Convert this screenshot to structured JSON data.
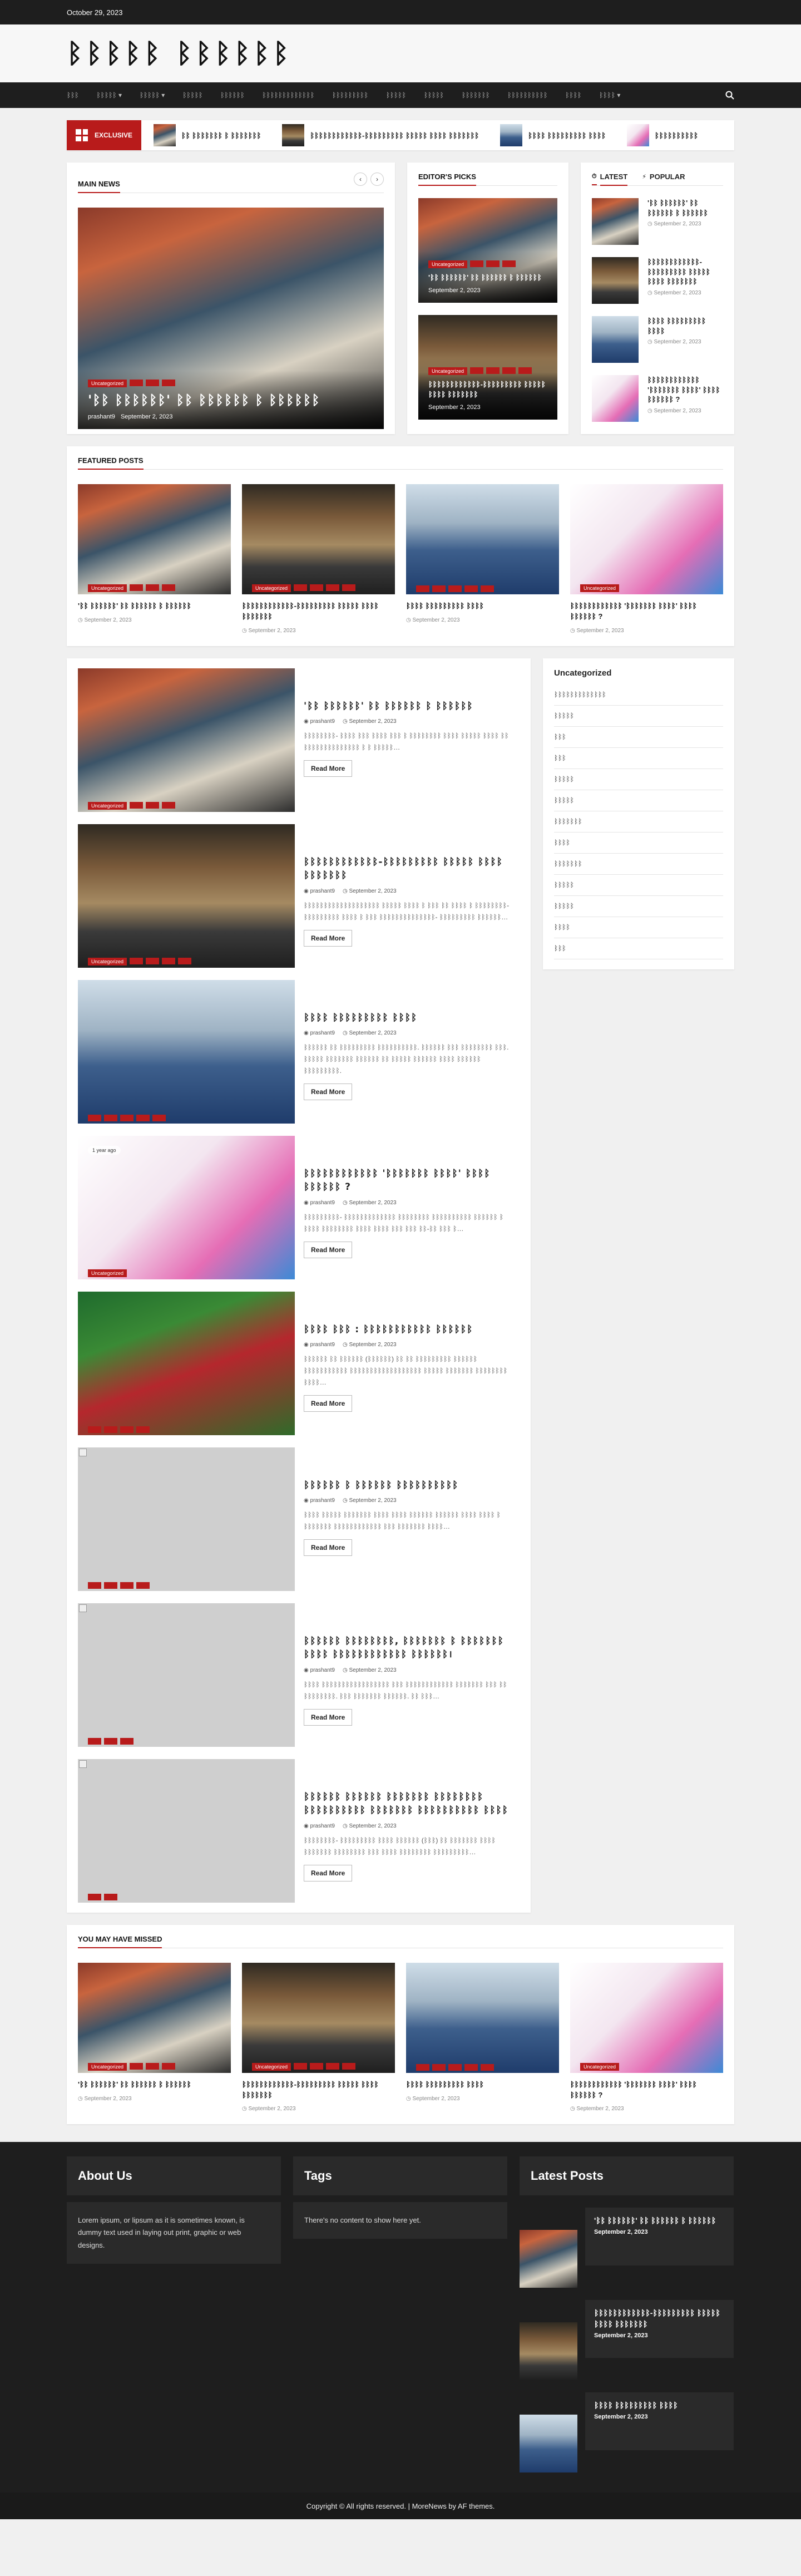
{
  "topbar": {
    "date": "October 29, 2023"
  },
  "site": {
    "title": "ᛒᛒᛒᛒᛒ ᛒᛒᛒᛒᛒᛒ"
  },
  "nav": {
    "items": [
      "ᛒᛒᛒ",
      "ᛒᛒᛒᛒᛒ ▾",
      "ᛒᛒᛒᛒᛒ ▾",
      "ᛒᛒᛒᛒᛒ",
      "ᛒᛒᛒᛒᛒᛒ",
      "ᛒᛒᛒᛒᛒᛒᛒᛒᛒᛒᛒᛒᛒ",
      "ᛒᛒᛒᛒᛒᛒᛒᛒᛒ",
      "ᛒᛒᛒᛒᛒ",
      "ᛒᛒᛒᛒᛒ",
      "ᛒᛒᛒᛒᛒᛒᛒ",
      "ᛒᛒᛒᛒᛒᛒᛒᛒᛒᛒ",
      "ᛒᛒᛒᛒ",
      "ᛒᛒᛒᛒ ▾"
    ],
    "search_icon": "search-icon"
  },
  "ticker": {
    "label": "EXCLUSIVE",
    "items": [
      "ᛒᛒ ᛒᛒᛒᛒᛒᛒᛒ ᛒ ᛒᛒᛒᛒᛒᛒᛒ",
      "ᛒᛒᛒᛒᛒᛒᛒᛒᛒᛒᛒᛒ-ᛒᛒᛒᛒᛒᛒᛒᛒᛒ ᛒᛒᛒᛒᛒ ᛒᛒᛒᛒ ᛒᛒᛒᛒᛒᛒᛒ",
      "ᛒᛒᛒᛒ ᛒᛒᛒᛒᛒᛒᛒᛒᛒ ᛒᛒᛒᛒ",
      "ᛒᛒᛒᛒᛒᛒᛒᛒᛒᛒ"
    ]
  },
  "main_news": {
    "title": "MAIN NEWS",
    "hero": {
      "tags": [
        "Uncategorized",
        "",
        "",
        ""
      ],
      "title": "'ᛒᛒ ᛒᛒᛒᛒᛒᛒ' ᛒᛒ ᛒᛒᛒᛒᛒᛒ ᛒ ᛒᛒᛒᛒᛒᛒ",
      "author": "prashant9",
      "date": "September 2, 2023"
    }
  },
  "editors_picks": {
    "title": "EDITOR'S PICKS",
    "items": [
      {
        "tags": [
          "Uncategorized",
          "",
          "",
          ""
        ],
        "title": "'ᛒᛒ ᛒᛒᛒᛒᛒᛒ' ᛒᛒ ᛒᛒᛒᛒᛒᛒ ᛒ ᛒᛒᛒᛒᛒᛒ",
        "date": "September 2, 2023"
      },
      {
        "tags": [
          "Uncategorized",
          "",
          "",
          "",
          ""
        ],
        "title": "ᛒᛒᛒᛒᛒᛒᛒᛒᛒᛒᛒᛒ-ᛒᛒᛒᛒᛒᛒᛒᛒᛒ ᛒᛒᛒᛒᛒ ᛒᛒᛒᛒ ᛒᛒᛒᛒᛒᛒᛒ",
        "date": "September 2, 2023"
      }
    ]
  },
  "latest_tabs": {
    "tabs": [
      "LATEST",
      "POPULAR"
    ],
    "items": [
      {
        "title": "'ᛒᛒ ᛒᛒᛒᛒᛒᛒ' ᛒᛒ ᛒᛒᛒᛒᛒᛒ ᛒ ᛒᛒᛒᛒᛒᛒ",
        "date": "September 2, 2023"
      },
      {
        "title": "ᛒᛒᛒᛒᛒᛒᛒᛒᛒᛒᛒᛒ-ᛒᛒᛒᛒᛒᛒᛒᛒᛒ ᛒᛒᛒᛒᛒ ᛒᛒᛒᛒ ᛒᛒᛒᛒᛒᛒᛒ",
        "date": "September 2, 2023"
      },
      {
        "title": "ᛒᛒᛒᛒ ᛒᛒᛒᛒᛒᛒᛒᛒᛒ ᛒᛒᛒᛒ",
        "date": "September 2, 2023"
      },
      {
        "title": "ᛒᛒᛒᛒᛒᛒᛒᛒᛒᛒᛒᛒ 'ᛒᛒᛒᛒᛒᛒᛒ ᛒᛒᛒᛒ' ᛒᛒᛒᛒ ᛒᛒᛒᛒᛒᛒ ?",
        "date": "September 2, 2023"
      }
    ]
  },
  "featured": {
    "title": "FEATURED POSTS",
    "items": [
      {
        "tags": [
          "Uncategorized",
          "",
          "",
          ""
        ],
        "title": "'ᛒᛒ ᛒᛒᛒᛒᛒᛒ' ᛒᛒ ᛒᛒᛒᛒᛒᛒ ᛒ ᛒᛒᛒᛒᛒᛒ",
        "date": "September 2, 2023"
      },
      {
        "tags": [
          "Uncategorized",
          "",
          "",
          "",
          ""
        ],
        "title": "ᛒᛒᛒᛒᛒᛒᛒᛒᛒᛒᛒᛒ-ᛒᛒᛒᛒᛒᛒᛒᛒᛒ ᛒᛒᛒᛒᛒ ᛒᛒᛒᛒ ᛒᛒᛒᛒᛒᛒᛒ",
        "date": "September 2, 2023"
      },
      {
        "tags": [
          "",
          "",
          "",
          "",
          ""
        ],
        "title": "ᛒᛒᛒᛒ ᛒᛒᛒᛒᛒᛒᛒᛒᛒ ᛒᛒᛒᛒ",
        "date": "September 2, 2023"
      },
      {
        "tags": [
          "Uncategorized"
        ],
        "title": "ᛒᛒᛒᛒᛒᛒᛒᛒᛒᛒᛒᛒ 'ᛒᛒᛒᛒᛒᛒᛒ ᛒᛒᛒᛒ' ᛒᛒᛒᛒ ᛒᛒᛒᛒᛒᛒ ?",
        "date": "September 2, 2023"
      }
    ]
  },
  "posts": {
    "read_more": "Read More",
    "items": [
      {
        "tags": [
          "Uncategorized",
          "",
          "",
          ""
        ],
        "title": "'ᛒᛒ ᛒᛒᛒᛒᛒᛒ' ᛒᛒ ᛒᛒᛒᛒᛒᛒ ᛒ ᛒᛒᛒᛒᛒᛒ",
        "author": "prashant9",
        "date": "September 2, 2023",
        "excerpt": "ᛒᛒᛒᛒᛒᛒᛒᛒ- ᛒᛒᛒᛒ ᛒᛒᛒ ᛒᛒᛒᛒ ᛒᛒᛒ ᛒ ᛒᛒᛒᛒᛒᛒᛒᛒ ᛒᛒᛒᛒ ᛒᛒᛒᛒᛒ ᛒᛒᛒᛒ ᛒᛒ ᛒᛒᛒᛒᛒᛒᛒᛒᛒᛒᛒᛒᛒᛒ ᛒ ᛒ ᛒᛒᛒᛒᛒ…",
        "badge": ""
      },
      {
        "tags": [
          "Uncategorized",
          "",
          "",
          "",
          ""
        ],
        "title": "ᛒᛒᛒᛒᛒᛒᛒᛒᛒᛒᛒᛒ-ᛒᛒᛒᛒᛒᛒᛒᛒᛒ ᛒᛒᛒᛒᛒ ᛒᛒᛒᛒ ᛒᛒᛒᛒᛒᛒᛒ",
        "author": "prashant9",
        "date": "September 2, 2023",
        "excerpt": "ᛒᛒᛒᛒᛒᛒᛒᛒᛒᛒᛒᛒᛒᛒᛒᛒᛒᛒᛒ ᛒᛒᛒᛒᛒ ᛒᛒᛒᛒ ᛒ ᛒᛒᛒ ᛒᛒ ᛒᛒᛒᛒ ᛒ ᛒᛒᛒᛒᛒᛒᛒᛒ-ᛒᛒᛒᛒᛒᛒᛒᛒᛒ ᛒᛒᛒᛒ ᛒ ᛒᛒᛒ ᛒᛒᛒᛒᛒᛒᛒᛒᛒᛒᛒᛒᛒᛒ- ᛒᛒᛒᛒᛒᛒᛒᛒᛒ ᛒᛒᛒᛒᛒᛒ…",
        "badge": ""
      },
      {
        "tags": [
          "",
          "",
          "",
          "",
          ""
        ],
        "title": "ᛒᛒᛒᛒ ᛒᛒᛒᛒᛒᛒᛒᛒᛒ ᛒᛒᛒᛒ",
        "author": "prashant9",
        "date": "September 2, 2023",
        "excerpt": "ᛒᛒᛒᛒᛒᛒ ᛒᛒ ᛒᛒᛒᛒᛒᛒᛒᛒᛒ ᛒᛒᛒᛒᛒᛒᛒᛒᛒᛒ. ᛒᛒᛒᛒᛒᛒ ᛒᛒᛒ ᛒᛒᛒᛒᛒᛒᛒᛒ ᛒᛒᛒ. ᛒᛒᛒᛒᛒ ᛒᛒᛒᛒᛒᛒᛒ ᛒᛒᛒᛒᛒᛒ ᛒᛒ ᛒᛒᛒᛒᛒ ᛒᛒᛒᛒᛒᛒ ᛒᛒᛒᛒ ᛒᛒᛒᛒᛒᛒ ᛒᛒᛒᛒᛒᛒᛒᛒᛒ.",
        "badge": ""
      },
      {
        "tags": [
          "Uncategorized"
        ],
        "title": "ᛒᛒᛒᛒᛒᛒᛒᛒᛒᛒᛒᛒ 'ᛒᛒᛒᛒᛒᛒᛒ ᛒᛒᛒᛒ' ᛒᛒᛒᛒ ᛒᛒᛒᛒᛒᛒ ?",
        "author": "prashant9",
        "date": "September 2, 2023",
        "excerpt": "ᛒᛒᛒᛒᛒᛒᛒᛒᛒ- ᛒᛒᛒᛒᛒᛒᛒᛒᛒᛒᛒᛒᛒ ᛒᛒᛒᛒᛒᛒᛒᛒ ᛒᛒᛒᛒᛒᛒᛒᛒᛒᛒ ᛒᛒᛒᛒᛒᛒ ᛒ ᛒᛒᛒᛒ ᛒᛒᛒᛒᛒᛒᛒᛒ ᛒᛒᛒᛒ ᛒᛒᛒᛒ ᛒᛒᛒ ᛒᛒᛒ ᛒᛒ-ᛒᛒ ᛒᛒᛒ ᛒ…",
        "badge": "1 year ago"
      },
      {
        "tags": [
          "",
          "",
          "",
          ""
        ],
        "title": "ᛒᛒᛒᛒ ᛒᛒᛒ : ᛒᛒᛒᛒᛒᛒᛒᛒᛒᛒᛒ ᛒᛒᛒᛒᛒᛒ",
        "author": "prashant9",
        "date": "September 2, 2023",
        "excerpt": "ᛒᛒᛒᛒᛒᛒ ᛒᛒ ᛒᛒᛒᛒᛒᛒ (ᛒᛒᛒᛒᛒᛒ) ᛒᛒ ᛒᛒ ᛒᛒᛒᛒᛒᛒᛒᛒᛒ ᛒᛒᛒᛒᛒᛒ ᛒᛒᛒᛒᛒᛒᛒᛒᛒᛒᛒ ᛒᛒᛒᛒᛒᛒᛒᛒᛒᛒᛒᛒᛒᛒᛒᛒᛒᛒ ᛒᛒᛒᛒᛒ ᛒᛒᛒᛒᛒᛒᛒ ᛒᛒᛒᛒᛒᛒᛒᛒ ᛒᛒᛒᛒ…",
        "badge": ""
      },
      {
        "tags": [
          "",
          "",
          "",
          ""
        ],
        "title": "ᛒᛒᛒᛒᛒᛒ ᛒ ᛒᛒᛒᛒᛒᛒ ᛒᛒᛒᛒᛒᛒᛒᛒᛒᛒ",
        "author": "prashant9",
        "date": "September 2, 2023",
        "excerpt": "ᛒᛒᛒᛒ ᛒᛒᛒᛒᛒ ᛒᛒᛒᛒᛒᛒᛒ ᛒᛒᛒᛒ ᛒᛒᛒᛒ ᛒᛒᛒᛒᛒᛒ ᛒᛒᛒᛒᛒᛒ ᛒᛒᛒᛒ ᛒᛒᛒᛒ ᛒ ᛒᛒᛒᛒᛒᛒᛒ ᛒᛒᛒᛒᛒᛒᛒᛒᛒᛒᛒᛒ ᛒᛒᛒ ᛒᛒᛒᛒᛒᛒᛒ ᛒᛒᛒᛒ…",
        "badge": ""
      },
      {
        "tags": [
          "",
          "",
          ""
        ],
        "title": "ᛒᛒᛒᛒᛒᛒ ᛒᛒᛒᛒᛒᛒᛒᛒ, ᛒᛒᛒᛒᛒᛒᛒ ᛒ ᛒᛒᛒᛒᛒᛒᛒ ᛒᛒᛒᛒ ᛒᛒᛒᛒᛒᛒᛒᛒᛒᛒᛒᛒ ᛒᛒᛒᛒᛒᛒ।",
        "author": "prashant9",
        "date": "September 2, 2023",
        "excerpt": "ᛒᛒᛒᛒ ᛒᛒᛒᛒᛒᛒᛒᛒᛒᛒᛒᛒᛒᛒᛒᛒᛒ ᛒᛒᛒ ᛒᛒᛒᛒᛒᛒᛒᛒᛒᛒᛒᛒ ᛒᛒᛒᛒᛒᛒᛒ ᛒᛒᛒ ᛒᛒ ᛒᛒᛒᛒᛒᛒᛒᛒ. ᛒᛒᛒ ᛒᛒᛒᛒᛒᛒᛒ ᛒᛒᛒᛒᛒᛒ. ᛒᛒ ᛒᛒᛒ…",
        "badge": ""
      },
      {
        "tags": [
          "",
          ""
        ],
        "title": "ᛒᛒᛒᛒᛒᛒ ᛒᛒᛒᛒᛒᛒ ᛒᛒᛒᛒᛒᛒᛒ ᛒᛒᛒᛒᛒᛒᛒᛒ ᛒᛒᛒᛒᛒᛒᛒᛒᛒᛒ ᛒᛒᛒᛒᛒᛒᛒ ᛒᛒᛒᛒᛒᛒᛒᛒᛒᛒ ᛒᛒᛒᛒ",
        "author": "prashant9",
        "date": "September 2, 2023",
        "excerpt": "ᛒᛒᛒᛒᛒᛒᛒᛒ- ᛒᛒᛒᛒᛒᛒᛒᛒᛒ ᛒᛒᛒᛒ ᛒᛒᛒᛒᛒᛒ (ᛒᛒᛒ) ᛒᛒ ᛒᛒᛒᛒᛒᛒᛒ ᛒᛒᛒᛒ ᛒᛒᛒᛒᛒᛒᛒ ᛒᛒᛒᛒᛒᛒᛒᛒ ᛒᛒᛒ ᛒᛒᛒᛒ ᛒᛒᛒᛒᛒᛒᛒᛒ ᛒᛒᛒᛒᛒᛒᛒᛒᛒ…",
        "badge": ""
      }
    ]
  },
  "sidebar": {
    "title": "Uncategorized",
    "items": [
      "ᛒᛒᛒᛒᛒᛒᛒᛒᛒᛒᛒᛒᛒ",
      "ᛒᛒᛒᛒᛒ",
      "ᛒᛒᛒ",
      "ᛒᛒᛒ",
      "ᛒᛒᛒᛒᛒ",
      "ᛒᛒᛒᛒᛒ",
      "ᛒᛒᛒᛒᛒᛒᛒ",
      "ᛒᛒᛒᛒ",
      "ᛒᛒᛒᛒᛒᛒᛒ",
      "ᛒᛒᛒᛒᛒ",
      "ᛒᛒᛒᛒᛒ",
      "ᛒᛒᛒᛒ",
      "ᛒᛒᛒ"
    ]
  },
  "missed": {
    "title": "YOU MAY HAVE MISSED",
    "items": [
      {
        "tags": [
          "Uncategorized",
          "",
          "",
          ""
        ],
        "title": "'ᛒᛒ ᛒᛒᛒᛒᛒᛒ' ᛒᛒ ᛒᛒᛒᛒᛒᛒ ᛒ ᛒᛒᛒᛒᛒᛒ",
        "date": "September 2, 2023"
      },
      {
        "tags": [
          "Uncategorized",
          "",
          "",
          "",
          ""
        ],
        "title": "ᛒᛒᛒᛒᛒᛒᛒᛒᛒᛒᛒᛒ-ᛒᛒᛒᛒᛒᛒᛒᛒᛒ ᛒᛒᛒᛒᛒ ᛒᛒᛒᛒ ᛒᛒᛒᛒᛒᛒᛒ",
        "date": "September 2, 2023"
      },
      {
        "tags": [
          "",
          "",
          "",
          "",
          ""
        ],
        "title": "ᛒᛒᛒᛒ ᛒᛒᛒᛒᛒᛒᛒᛒᛒ ᛒᛒᛒᛒ",
        "date": "September 2, 2023"
      },
      {
        "tags": [
          "Uncategorized"
        ],
        "title": "ᛒᛒᛒᛒᛒᛒᛒᛒᛒᛒᛒᛒ 'ᛒᛒᛒᛒᛒᛒᛒ ᛒᛒᛒᛒ' ᛒᛒᛒᛒ ᛒᛒᛒᛒᛒᛒ ?",
        "date": "September 2, 2023"
      }
    ]
  },
  "footer": {
    "about_title": "About Us",
    "about_text": "Lorem ipsum, or lipsum as it is sometimes known, is dummy text used in laying out print, graphic or web designs.",
    "tags_title": "Tags",
    "tags_text": "There's no content to show here yet.",
    "latest_title": "Latest Posts",
    "latest": [
      {
        "title": "'ᛒᛒ ᛒᛒᛒᛒᛒᛒ' ᛒᛒ ᛒᛒᛒᛒᛒᛒ ᛒ ᛒᛒᛒᛒᛒᛒ",
        "date": "September 2, 2023"
      },
      {
        "title": "ᛒᛒᛒᛒᛒᛒᛒᛒᛒᛒᛒᛒ-ᛒᛒᛒᛒᛒᛒᛒᛒᛒ ᛒᛒᛒᛒᛒ ᛒᛒᛒᛒ ᛒᛒᛒᛒᛒᛒᛒ",
        "date": "September 2, 2023"
      },
      {
        "title": "ᛒᛒᛒᛒ ᛒᛒᛒᛒᛒᛒᛒᛒᛒ ᛒᛒᛒᛒ",
        "date": "September 2, 2023"
      }
    ],
    "copyright": "Copyright © All rights reserved. | MoreNews by AF themes."
  },
  "colors": {
    "accent": "#b81b1b",
    "dark": "#1e1e1e"
  }
}
